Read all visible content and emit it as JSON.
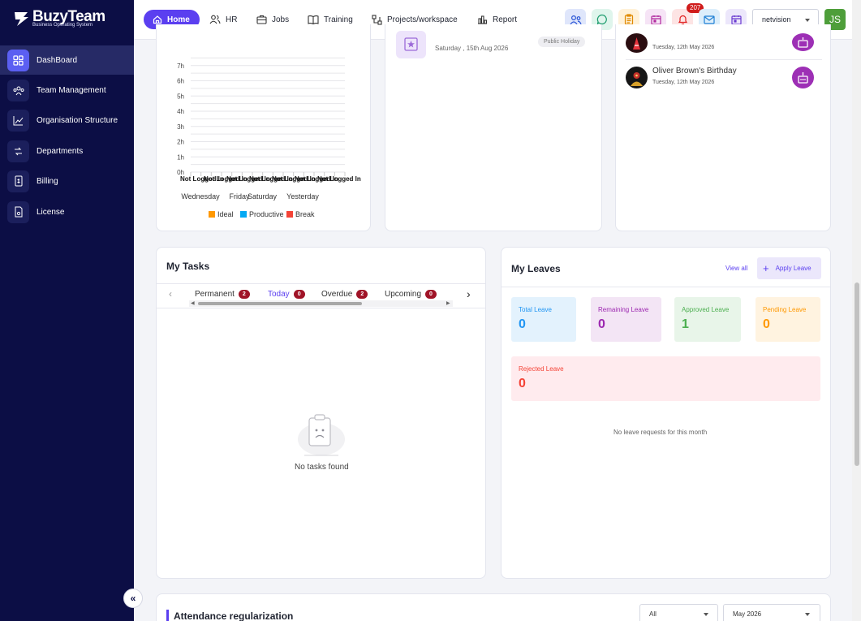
{
  "brand": {
    "name": "BuzyTeam",
    "tagline": "Business Operating System"
  },
  "sidebar": {
    "items": [
      {
        "label": "DashBoard",
        "icon": "grid-icon",
        "active": true
      },
      {
        "label": "Team Management",
        "icon": "team-icon",
        "active": false
      },
      {
        "label": "Organisation Structure",
        "icon": "org-chart-icon",
        "active": false
      },
      {
        "label": "Departments",
        "icon": "departments-icon",
        "active": false
      },
      {
        "label": "Billing",
        "icon": "billing-icon",
        "active": false
      },
      {
        "label": "License",
        "icon": "license-icon",
        "active": false
      }
    ],
    "collapse_label": "«"
  },
  "topnav": {
    "items": [
      {
        "label": "Home",
        "icon": "home-icon"
      },
      {
        "label": "HR",
        "icon": "people-icon"
      },
      {
        "label": "Jobs",
        "icon": "briefcase-icon"
      },
      {
        "label": "Training",
        "icon": "book-icon"
      },
      {
        "label": "Projects/workspace",
        "icon": "projects-icon"
      },
      {
        "label": "Report",
        "icon": "bar-chart-icon"
      }
    ],
    "notification_count": "207",
    "org_select": "netvision",
    "user_initials": "JS",
    "quick_colors": {
      "people": "#dfe6fb",
      "chat": "#dff5ec",
      "clipboard": "#fff1d8",
      "calendar": "#f6e4f6",
      "bell": "#fde4e4",
      "mail": "#dceefb",
      "calendar2": "#ece7fb"
    }
  },
  "chart_data": {
    "type": "bar",
    "title": "",
    "categories": [
      "Wednesday",
      "Friday",
      "Saturday",
      "Yesterday"
    ],
    "tick_labels": [
      "Wednesday",
      "Friday",
      "Saturday",
      "Yesterday"
    ],
    "y_tick_labels": [
      "0h",
      "1h",
      "2h",
      "3h",
      "4h",
      "5h",
      "6h",
      "7h"
    ],
    "ylim": [
      0,
      8
    ],
    "bar_annotation": "Not Logged In",
    "series": [
      {
        "name": "Ideal",
        "color": "#ff9800",
        "values": [
          0,
          0,
          0,
          0
        ]
      },
      {
        "name": "Productive",
        "color": "#03a9f4",
        "values": [
          0,
          0,
          0,
          0
        ]
      },
      {
        "name": "Break",
        "color": "#f44336",
        "values": [
          0,
          0,
          0,
          0
        ]
      }
    ],
    "grid": true,
    "legend": "bottom"
  },
  "holiday": {
    "date": "Saturday , 15th Aug 2026",
    "badge": "Public Holiday"
  },
  "birthdays": [
    {
      "name": "",
      "date": "Tuesday, 12th May 2026"
    },
    {
      "name": "Oliver Brown's Birthday",
      "date": "Tuesday, 12th May 2026"
    }
  ],
  "tasks": {
    "title": "My Tasks",
    "tabs": [
      {
        "label": "Permanent",
        "count": "2"
      },
      {
        "label": "Today",
        "count": "0"
      },
      {
        "label": "Overdue",
        "count": "2"
      },
      {
        "label": "Upcoming",
        "count": "0"
      }
    ],
    "empty_text": "No tasks found"
  },
  "leaves": {
    "title": "My Leaves",
    "view_all": "View all",
    "apply": "Apply Leave",
    "stats": [
      {
        "label": "Total Leave",
        "value": "0",
        "color": "#2196f3",
        "bg": "#e3f2fd"
      },
      {
        "label": "Remaining Leave",
        "value": "0",
        "color": "#9c27b0",
        "bg": "#f3e5f5"
      },
      {
        "label": "Approved Leave",
        "value": "1",
        "color": "#4caf50",
        "bg": "#e8f5e9"
      },
      {
        "label": "Pending Leave",
        "value": "0",
        "color": "#ff9800",
        "bg": "#fff3e0"
      },
      {
        "label": "Rejected Leave",
        "value": "0",
        "color": "#f44336",
        "bg": "#ffebee"
      }
    ],
    "empty_text": "No leave requests for this month"
  },
  "attendance": {
    "title": "Attendance regularization",
    "filter": "All",
    "month": "May 2026"
  }
}
